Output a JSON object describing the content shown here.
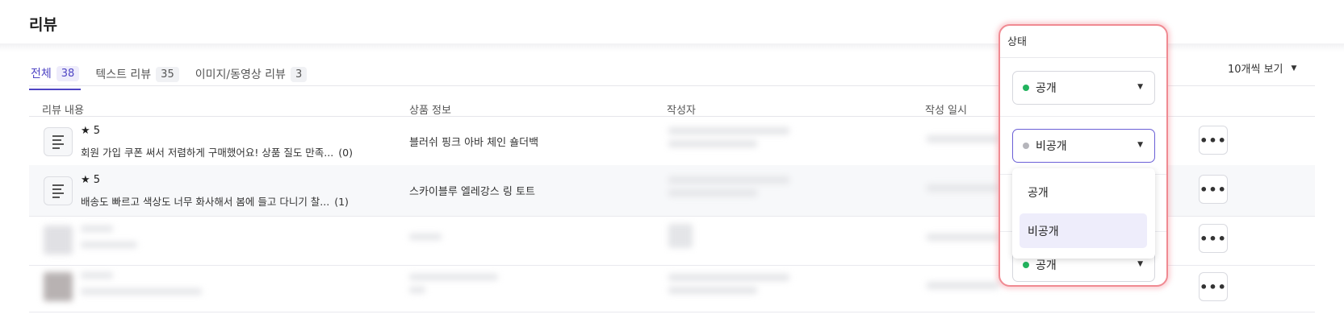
{
  "header": {
    "title": "리뷰"
  },
  "tabs": [
    {
      "label": "전체",
      "count": "38"
    },
    {
      "label": "텍스트 리뷰",
      "count": "35"
    },
    {
      "label": "이미지/동영상 리뷰",
      "count": "3"
    }
  ],
  "page_size": {
    "label": "10개씩 보기"
  },
  "table": {
    "columns": [
      "리뷰 내용",
      "상품 정보",
      "작성자",
      "작성 일시"
    ],
    "rows": [
      {
        "rating": "★ 5",
        "content": "회원 가입 쿠폰 써서 저렴하게 구매했어요! 상품 질도 만족...",
        "comments": "(0)",
        "product": "블러쉬 핑크 아바 체인 숄더백"
      },
      {
        "rating": "★ 5",
        "content": "배송도 빠르고 색상도 너무 화사해서 봄에 들고 다니기 찰...",
        "comments": "(1)",
        "product": "스카이블루 엘레강스 링 토트"
      }
    ]
  },
  "status_panel": {
    "title": "상태",
    "selects": [
      {
        "value": "공개",
        "dot_color": "#22b35e"
      },
      {
        "value": "비공개",
        "dot_color": "#b5b5bb"
      },
      {
        "value": "공개",
        "dot_color": "#22b35e"
      }
    ],
    "options": [
      "공개",
      "비공개"
    ],
    "highlighted_option": "비공개"
  },
  "colors": {
    "accent": "#4f45c4",
    "highlight_border": "#f08a92",
    "public_dot": "#22b35e",
    "private_dot": "#b5b5bb"
  },
  "icons": {
    "thumb": "text-lines-icon",
    "more": "more-dots-icon",
    "dropdown": "caret-down-icon"
  }
}
